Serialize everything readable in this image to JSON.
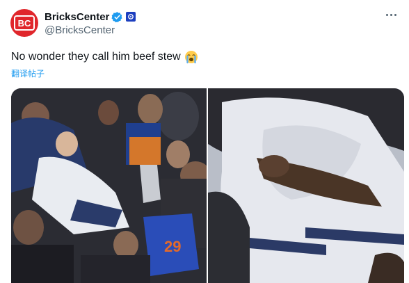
{
  "author": {
    "display_name": "BricksCenter",
    "handle": "@BricksCenter",
    "avatar_text": "BC",
    "verified": true
  },
  "tweet": {
    "text": "No wonder they call him beef stew",
    "emoji": "loudly-crying-face",
    "translate_label": "翻译帖子"
  },
  "media": {
    "images": [
      {
        "name": "crowd-scuffle-wide-shot"
      },
      {
        "name": "crowd-scuffle-close-up"
      }
    ]
  },
  "colors": {
    "brand_red": "#e0262b",
    "verified_blue": "#1d9bf0",
    "link_blue": "#1d9bf0",
    "secondary_text": "#536471"
  }
}
